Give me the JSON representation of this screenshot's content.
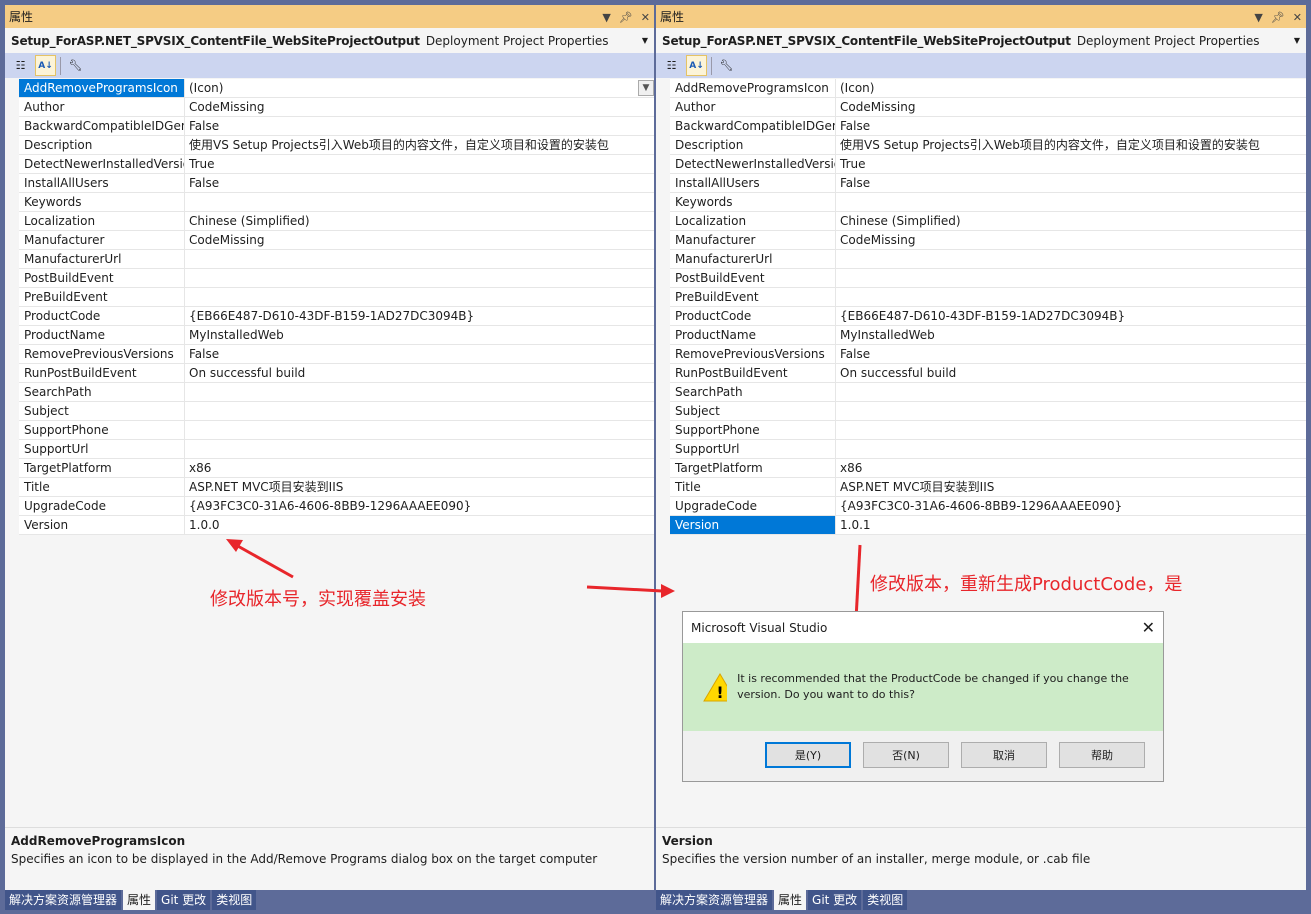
{
  "left": {
    "title": "属性",
    "object": "Setup_ForASP.NET_SPVSIX_ContentFile_WebSiteProjectOutput",
    "object_type": "Deployment Project Properties",
    "properties": [
      [
        "AddRemoveProgramsIcon",
        "(Icon)"
      ],
      [
        "Author",
        "CodeMissing"
      ],
      [
        "BackwardCompatibleIDGen",
        "False"
      ],
      [
        "Description",
        "使用VS Setup Projects引入Web项目的内容文件，自定义项目和设置的安装包"
      ],
      [
        "DetectNewerInstalledVersio",
        "True"
      ],
      [
        "InstallAllUsers",
        "False"
      ],
      [
        "Keywords",
        ""
      ],
      [
        "Localization",
        "Chinese (Simplified)"
      ],
      [
        "Manufacturer",
        "CodeMissing"
      ],
      [
        "ManufacturerUrl",
        ""
      ],
      [
        "PostBuildEvent",
        ""
      ],
      [
        "PreBuildEvent",
        ""
      ],
      [
        "ProductCode",
        "{EB66E487-D610-43DF-B159-1AD27DC3094B}"
      ],
      [
        "ProductName",
        "MyInstalledWeb"
      ],
      [
        "RemovePreviousVersions",
        "False"
      ],
      [
        "RunPostBuildEvent",
        "On successful build"
      ],
      [
        "SearchPath",
        ""
      ],
      [
        "Subject",
        ""
      ],
      [
        "SupportPhone",
        ""
      ],
      [
        "SupportUrl",
        ""
      ],
      [
        "TargetPlatform",
        "x86"
      ],
      [
        "Title",
        "ASP.NET MVC项目安装到IIS"
      ],
      [
        "UpgradeCode",
        "{A93FC3C0-31A6-4606-8BB9-1296AAAEE090}"
      ],
      [
        "Version",
        "1.0.0"
      ]
    ],
    "selected": 0,
    "desc_title": "AddRemoveProgramsIcon",
    "desc_text": "Specifies an icon to be displayed in the Add/Remove Programs dialog box on the target computer"
  },
  "right": {
    "title": "属性",
    "object": "Setup_ForASP.NET_SPVSIX_ContentFile_WebSiteProjectOutput",
    "object_type": "Deployment Project Properties",
    "properties": [
      [
        "AddRemoveProgramsIcon",
        "(Icon)"
      ],
      [
        "Author",
        "CodeMissing"
      ],
      [
        "BackwardCompatibleIDGen",
        "False"
      ],
      [
        "Description",
        "使用VS Setup Projects引入Web项目的内容文件，自定义项目和设置的安装包"
      ],
      [
        "DetectNewerInstalledVersio",
        "True"
      ],
      [
        "InstallAllUsers",
        "False"
      ],
      [
        "Keywords",
        ""
      ],
      [
        "Localization",
        "Chinese (Simplified)"
      ],
      [
        "Manufacturer",
        "CodeMissing"
      ],
      [
        "ManufacturerUrl",
        ""
      ],
      [
        "PostBuildEvent",
        ""
      ],
      [
        "PreBuildEvent",
        ""
      ],
      [
        "ProductCode",
        "{EB66E487-D610-43DF-B159-1AD27DC3094B}"
      ],
      [
        "ProductName",
        "MyInstalledWeb"
      ],
      [
        "RemovePreviousVersions",
        "False"
      ],
      [
        "RunPostBuildEvent",
        "On successful build"
      ],
      [
        "SearchPath",
        ""
      ],
      [
        "Subject",
        ""
      ],
      [
        "SupportPhone",
        ""
      ],
      [
        "SupportUrl",
        ""
      ],
      [
        "TargetPlatform",
        "x86"
      ],
      [
        "Title",
        "ASP.NET MVC项目安装到IIS"
      ],
      [
        "UpgradeCode",
        "{A93FC3C0-31A6-4606-8BB9-1296AAAEE090}"
      ],
      [
        "Version",
        "1.0.1"
      ]
    ],
    "selected": 23,
    "desc_title": "Version",
    "desc_text": "Specifies the version number of an installer, merge module, or .cab file"
  },
  "tabs": [
    "解决方案资源管理器",
    "属性",
    "Git 更改",
    "类视图"
  ],
  "active_tab": 1,
  "annotations": {
    "left": "修改版本号，实现覆盖安装",
    "right": "修改版本，重新生成ProductCode，是"
  },
  "dialog": {
    "title": "Microsoft Visual Studio",
    "message": "It is recommended that the ProductCode be changed if you change the version. Do you want to do this?",
    "buttons": [
      "是(Y)",
      "否(N)",
      "取消",
      "帮助"
    ]
  },
  "colors": {
    "selection": "#0078d7",
    "title_active": "#f5cc84",
    "annotation": "#e8262b",
    "dialog_body": "#cdebc8"
  }
}
